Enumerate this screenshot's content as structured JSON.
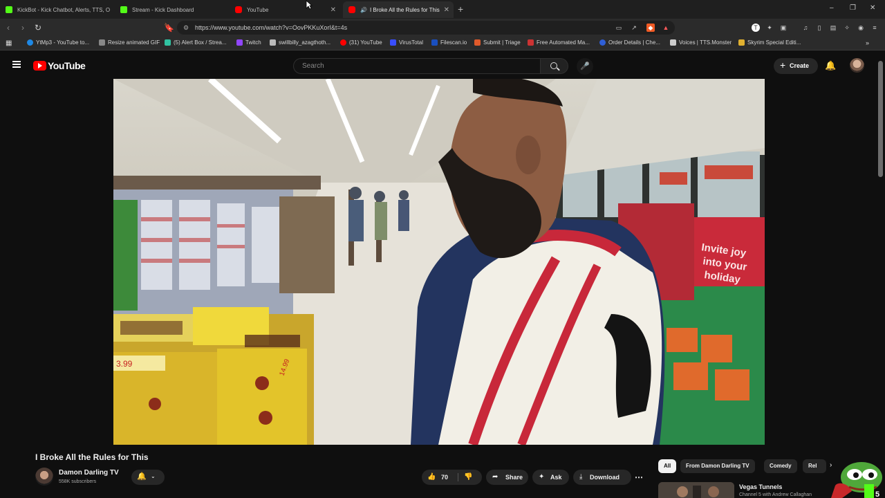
{
  "browser": {
    "tabs": [
      {
        "label": "KickBot - Kick Chatbot, Alerts, TTS, O",
        "color": "#53fc18"
      },
      {
        "label": "Stream - Kick Dashboard",
        "color": "#53fc18"
      },
      {
        "label": "YouTube",
        "color": "#ff0000"
      },
      {
        "label": "I Broke All the Rules for This",
        "color": "#ff0000"
      }
    ],
    "url": "https://www.youtube.com/watch?v=OovPKKuXorI&t=4s",
    "bookmarks": [
      {
        "label": "YtMp3 - YouTube to...",
        "color": "#1e88e5"
      },
      {
        "label": "Resize animated GIF",
        "color": "#888888"
      },
      {
        "label": "(5) Alert Box / Strea...",
        "color": "#31c3a2"
      },
      {
        "label": "Twitch",
        "color": "#9146ff"
      },
      {
        "label": "swillbilly_azagthoth...",
        "color": "#bbbbbb"
      },
      {
        "label": "(31) YouTube",
        "color": "#ff0000"
      },
      {
        "label": "VirusTotal",
        "color": "#394eff"
      },
      {
        "label": "Filescan.io",
        "color": "#1a4fbf"
      },
      {
        "label": "Submit | Triage",
        "color": "#e05a2b"
      },
      {
        "label": "Free Automated Ma...",
        "color": "#cc3333"
      },
      {
        "label": "Order Details | Che...",
        "color": "#2f5fd6"
      },
      {
        "label": "Voices | TTS.Monster",
        "color": "#cccccc"
      },
      {
        "label": "Skyrim Special Editi...",
        "color": "#e0b030"
      }
    ]
  },
  "header": {
    "logo_text": "YouTube",
    "search_placeholder": "Search",
    "create_label": "Create"
  },
  "video": {
    "title": "I Broke All the Rules for This",
    "channel": "Damon Darling TV",
    "subscribers": "558K subscribers",
    "like_count": "70",
    "share_label": "Share",
    "ask_label": "Ask",
    "download_label": "Download",
    "price_sign_1": "3.99",
    "price_sign_2": "14.99",
    "sign_text_1": "Invite joy",
    "sign_text_2": "into your",
    "sign_text_3": "holiday"
  },
  "chips": [
    "All",
    "From Damon Darling TV",
    "Comedy",
    "Rel"
  ],
  "recommended": {
    "title": "Vegas Tunnels",
    "channel": "Channel 5 with Andrew Callaghan"
  },
  "colors": {
    "background": "#0f0f0f",
    "accent": "#ff0000",
    "kick_green": "#53fc18"
  }
}
